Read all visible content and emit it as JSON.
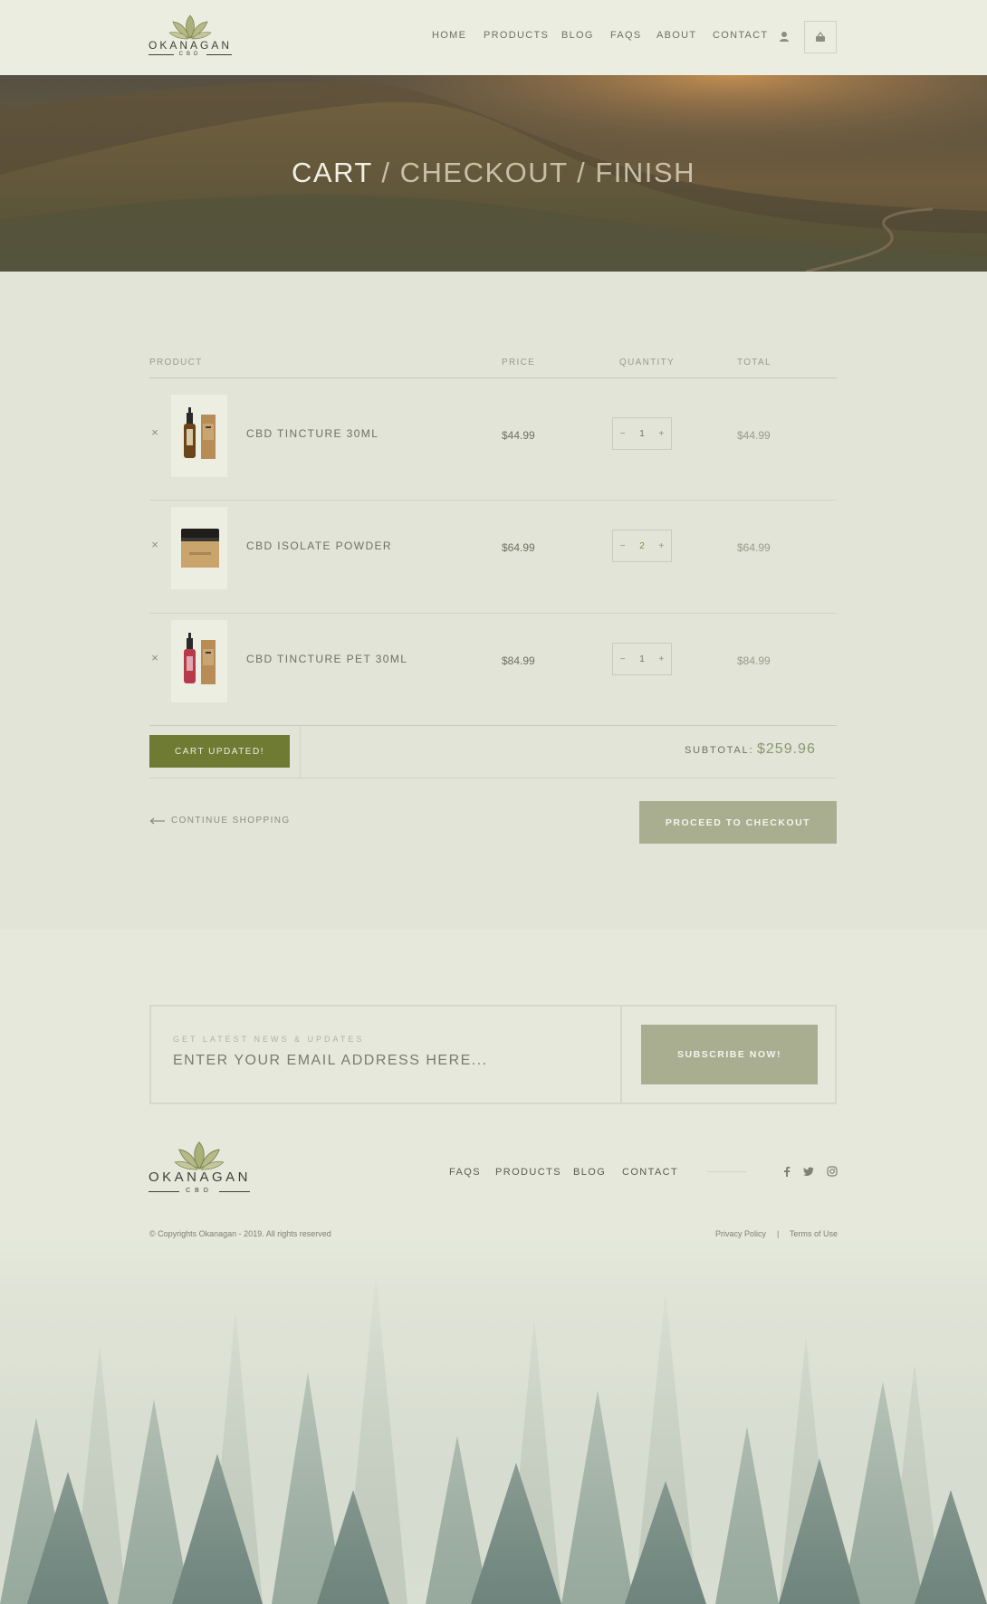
{
  "brand": {
    "name": "OKANAGAN",
    "sub": "CBD"
  },
  "header": {
    "nav": [
      "HOME",
      "PRODUCTS",
      "BLOG",
      "FAQS",
      "ABOUT",
      "CONTACT"
    ]
  },
  "hero": {
    "current_step": "CART",
    "other_steps": "/ CHECKOUT / FINISH"
  },
  "cart": {
    "columns": {
      "product": "PRODUCT",
      "price": "PRICE",
      "quantity": "QUANTITY",
      "total": "TOTAL"
    },
    "remove_glyph": "×",
    "minus_glyph": "−",
    "plus_glyph": "+",
    "items": [
      {
        "name": "CBD TINCTURE 30ML",
        "price": "$44.99",
        "qty": "1",
        "total": "$44.99",
        "image": "tincture-bottle-amber"
      },
      {
        "name": "CBD ISOLATE POWDER",
        "price": "$64.99",
        "qty": "2",
        "total": "$64.99",
        "image": "powder-jar"
      },
      {
        "name": "CBD TINCTURE PET 30ML",
        "price": "$84.99",
        "qty": "1",
        "total": "$84.99",
        "image": "tincture-bottle-red"
      }
    ],
    "update_button": "CART UPDATED!",
    "subtotal_label": "SUBTOTAL:",
    "subtotal_value": "$259.96",
    "continue_link": "CONTINUE SHOPPING",
    "checkout_button": "PROCEED TO CHECKOUT"
  },
  "newsletter": {
    "label": "GET LATEST NEWS & UPDATES",
    "placeholder": "ENTER YOUR EMAIL ADDRESS HERE...",
    "button": "SUBSCRIBE NOW!"
  },
  "footer": {
    "nav": [
      "FAQS",
      "PRODUCTS",
      "BLOG",
      "CONTACT"
    ],
    "social_icons": [
      "facebook-icon",
      "twitter-icon",
      "instagram-icon"
    ],
    "copyright": "© Copyrights Okanagan - 2019. All rights reserved",
    "privacy": "Privacy Policy",
    "separator": "|",
    "terms": "Terms of Use"
  },
  "colors": {
    "accent_green": "#6f7a33",
    "button_sage": "#a9ae90",
    "subtotal": "#8d9670"
  }
}
